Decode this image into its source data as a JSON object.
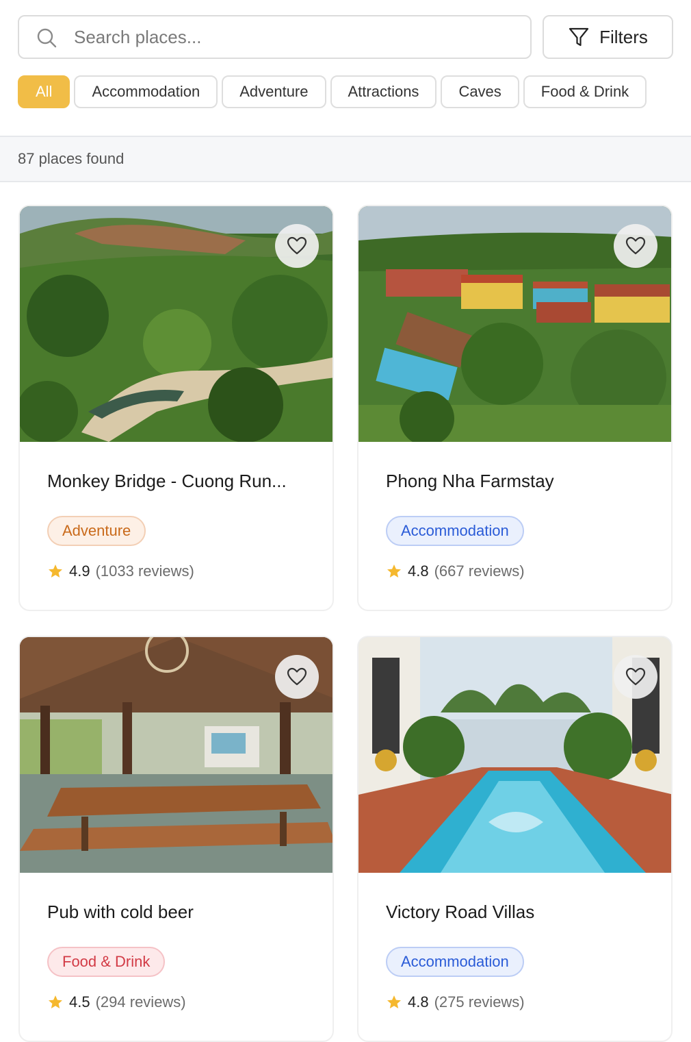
{
  "search": {
    "placeholder": "Search places..."
  },
  "filters_label": "Filters",
  "categories": [
    "All",
    "Accommodation",
    "Adventure",
    "Attractions",
    "Caves",
    "Food & Drink"
  ],
  "results_text": "87 places found",
  "places": [
    {
      "title": "Monkey Bridge - Cuong Run...",
      "category": "Adventure",
      "rating": "4.9",
      "reviews": "(1033 reviews)"
    },
    {
      "title": "Phong Nha Farmstay",
      "category": "Accommodation",
      "rating": "4.8",
      "reviews": "(667 reviews)"
    },
    {
      "title": "Pub with cold beer",
      "category": "Food & Drink",
      "rating": "4.5",
      "reviews": "(294 reviews)"
    },
    {
      "title": "Victory Road Villas",
      "category": "Accommodation",
      "rating": "4.8",
      "reviews": "(275 reviews)"
    }
  ],
  "colors": {
    "active_chip": "#f1bd47",
    "adventure": "#c96a1a",
    "accommodation": "#2a5bd7",
    "food": "#d23a45",
    "star": "#f5b82e"
  },
  "icons": {
    "search": "search-icon",
    "filter": "filter-icon",
    "favorite": "heart-icon",
    "rating": "star-icon"
  }
}
